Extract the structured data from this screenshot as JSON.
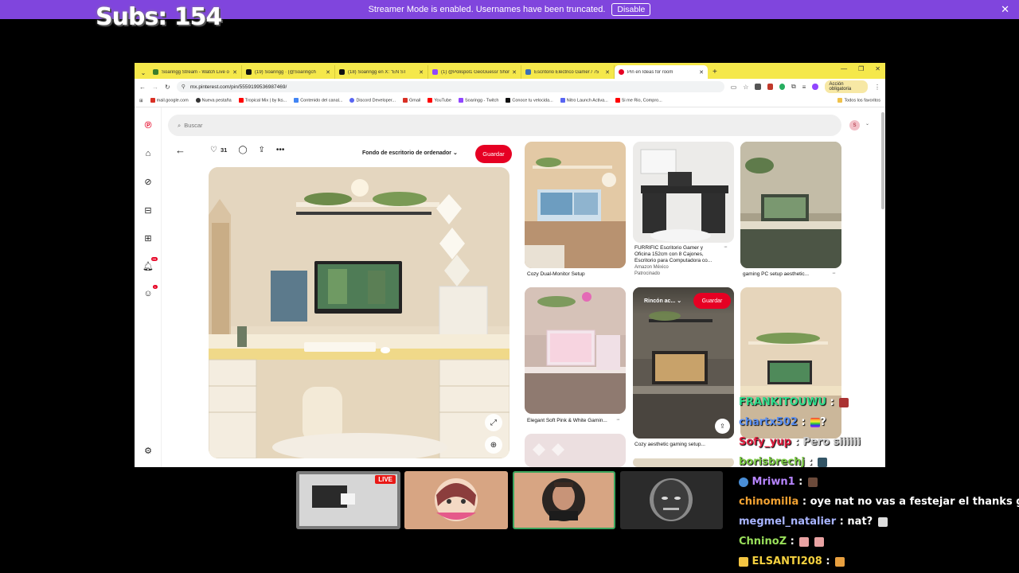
{
  "streamer_banner": {
    "text": "Streamer Mode is enabled. Usernames have been truncated.",
    "button": "Disable",
    "close": "✕"
  },
  "overlay": {
    "subs": "Subs: 154"
  },
  "browser": {
    "tabs": [
      {
        "title": "Soaringg Stream - Watch Live o",
        "color": "#3a7d2b"
      },
      {
        "title": "(19) Soaringg  · (@Soaringch",
        "color": "#111111"
      },
      {
        "title": "(18) Soaringg  en X: \"EN ST",
        "color": "#111111"
      },
      {
        "title": "(1) @Polispol1 GeoGuessr Shor",
        "color": "#9146ff"
      },
      {
        "title": "Escritorio Eléctrico Gamer / 75",
        "color": "#3b6fb6"
      },
      {
        "title": "Pin en Ideas for room",
        "color": "#e60023"
      }
    ],
    "new_tab": "+",
    "url": "mx.pinterest.com/pin/5559199536987469/",
    "accion": "Acción obligatoria",
    "bookmarks": [
      {
        "label": "mail.google.com",
        "color": "#d93025"
      },
      {
        "label": "Nueva pestaña",
        "color": "#333333"
      },
      {
        "label": "Tropical Mix | by lks...",
        "color": "#ff0000"
      },
      {
        "label": "Contenido del canal...",
        "color": "#4285f4"
      },
      {
        "label": "Discord Developer...",
        "color": "#5865f2"
      },
      {
        "label": "Gmail",
        "color": "#d93025"
      },
      {
        "label": "YouTube",
        "color": "#ff0000"
      },
      {
        "label": "Soaringg - Twitch",
        "color": "#9146ff"
      },
      {
        "label": "Conoce tu velocida...",
        "color": "#111111"
      },
      {
        "label": "Nitro Launch Activa...",
        "color": "#5865f2"
      },
      {
        "label": "Si me Rio, Compro...",
        "color": "#ff0000"
      }
    ],
    "all_favorites": "Todos los favoritos"
  },
  "pinterest": {
    "search_placeholder": "Buscar",
    "avatar_initial": "S",
    "notification_badge": "99",
    "messages_badge": "1",
    "like_count": "31",
    "board_select": "Fondo de escritorio de ordenador",
    "save_label": "Guardar",
    "related_pins": [
      {
        "caption": "Cozy Dual-Monitor Setup"
      },
      {
        "caption": "FURRIFIC Escritorio Gamer y",
        "caption2": "Oficina 152cm con 8 Cajones,",
        "caption3": "Escritorio para Computadora co...",
        "source": "Amazon México",
        "sponsored": "Patrocinado"
      },
      {
        "caption": "gaming PC setup aesthetic..."
      },
      {
        "caption": "Elegant Soft Pink & White Gamin..."
      },
      {
        "caption": "Cozy aesthetic gaming setup..."
      }
    ],
    "hover_board": "Rincón ac...",
    "hover_save": "Guardar"
  },
  "chat": [
    {
      "user": "FRANKITOUWU",
      "msg": "",
      "color": "#2fdc8c"
    },
    {
      "user": "chartx502",
      "msg": "?",
      "color": "#5b8ff0"
    },
    {
      "user": "Sofy_yup",
      "msg": "Pero siiiiii",
      "color": "#e02040"
    },
    {
      "user": "borisbrechj",
      "msg": "",
      "color": "#7ac943"
    },
    {
      "user": "Mriwn1",
      "msg": "",
      "color": "#b785ff"
    },
    {
      "user": "chinomilla",
      "msg": "oye nat no vas a festejar el thanks giving?",
      "color": "#f2a232"
    },
    {
      "user": "megmel_natalier",
      "msg": "nat?",
      "color": "#a8b4ff"
    },
    {
      "user": "ChninoZ",
      "msg": "",
      "color": "#9ae05b"
    },
    {
      "user": "ELSANTI208",
      "msg": "",
      "color": "#f4d03f"
    }
  ],
  "colors": {
    "discord_purple": "#8045dd",
    "browser_theme": "#f5e84b",
    "pinterest_red": "#e60023"
  },
  "live_badge": "LIVE"
}
